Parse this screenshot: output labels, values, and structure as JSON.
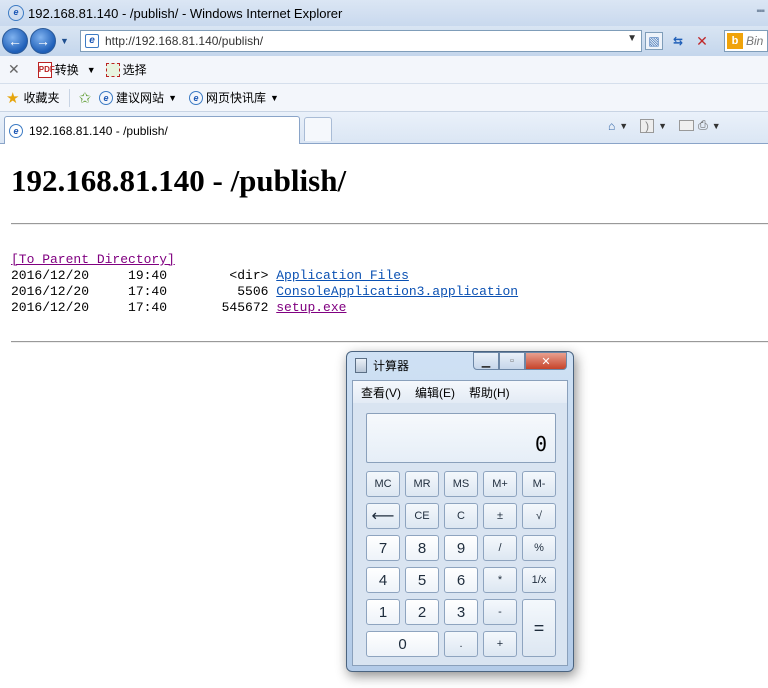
{
  "browser": {
    "window_title": "192.168.81.140 - /publish/ - Windows Internet Explorer",
    "url": "http://192.168.81.140/publish/",
    "search_placeholder": "Bin",
    "commandbar": {
      "convert_label": "转换",
      "select_label": "选择"
    },
    "favorites": {
      "label": "收藏夹",
      "suggested_sites": "建议网站",
      "web_slices": "网页快讯库"
    },
    "tab_title": "192.168.81.140 - /publish/"
  },
  "page": {
    "heading": "192.168.81.140 - /publish/",
    "parent_link": "[To Parent Directory]",
    "rows": [
      {
        "prefix": "2016/12/20     19:40        <dir> ",
        "name": "Application Files",
        "visited": false
      },
      {
        "prefix": "2016/12/20     17:40         5506 ",
        "name": "ConsoleApplication3.application",
        "visited": false
      },
      {
        "prefix": "2016/12/20     17:40       545672 ",
        "name": "setup.exe",
        "visited": true
      }
    ]
  },
  "calculator": {
    "title": "计算器",
    "menu": [
      "查看(V)",
      "编辑(E)",
      "帮助(H)"
    ],
    "display": "0",
    "keys": {
      "mc": "MC",
      "mr": "MR",
      "ms": "MS",
      "mplus": "M+",
      "mminus": "M-",
      "back": "⟵",
      "ce": "CE",
      "c": "C",
      "plusminus": "±",
      "sqrt": "√",
      "seven": "7",
      "eight": "8",
      "nine": "9",
      "div": "/",
      "pct": "%",
      "four": "4",
      "five": "5",
      "six": "6",
      "mul": "*",
      "recip": "1/x",
      "one": "1",
      "two": "2",
      "three": "3",
      "minus": "-",
      "eq": "=",
      "zero": "0",
      "dot": ".",
      "plus": "+"
    }
  }
}
